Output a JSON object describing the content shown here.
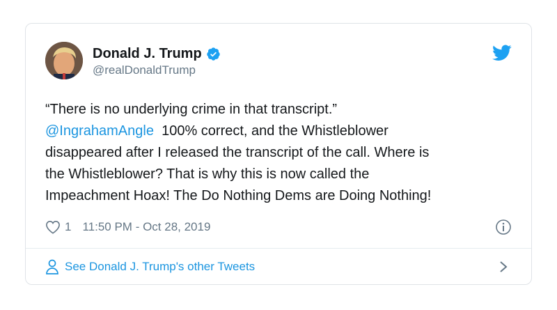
{
  "tweet": {
    "author": {
      "display_name": "Donald J. Trump",
      "handle": "@realDonaldTrump",
      "verified": true
    },
    "text_lines": [
      "“There is no underlying crime in that transcript.”",
      "disappeared after I released the transcript of the call. Where is",
      "the Whistleblower? That is why this is now called the",
      "Impeachment Hoax! The Do Nothing Dems are Doing Nothing!"
    ],
    "mention": "@IngrahamAngle",
    "mention_line_rest": "100% correct, and the Whistleblower",
    "likes": "1",
    "timestamp": "11:50 PM - Oct 28, 2019"
  },
  "footer": {
    "link_text": "See Donald J. Trump's other Tweets"
  },
  "colors": {
    "link": "#1b95e0",
    "secondary_text": "#657786",
    "border": "#dfe3e7",
    "primary_text": "#14171a"
  },
  "icons": [
    "avatar",
    "verified-badge-icon",
    "twitter-bird-icon",
    "heart-icon",
    "info-icon",
    "person-icon",
    "chevron-right-icon"
  ]
}
